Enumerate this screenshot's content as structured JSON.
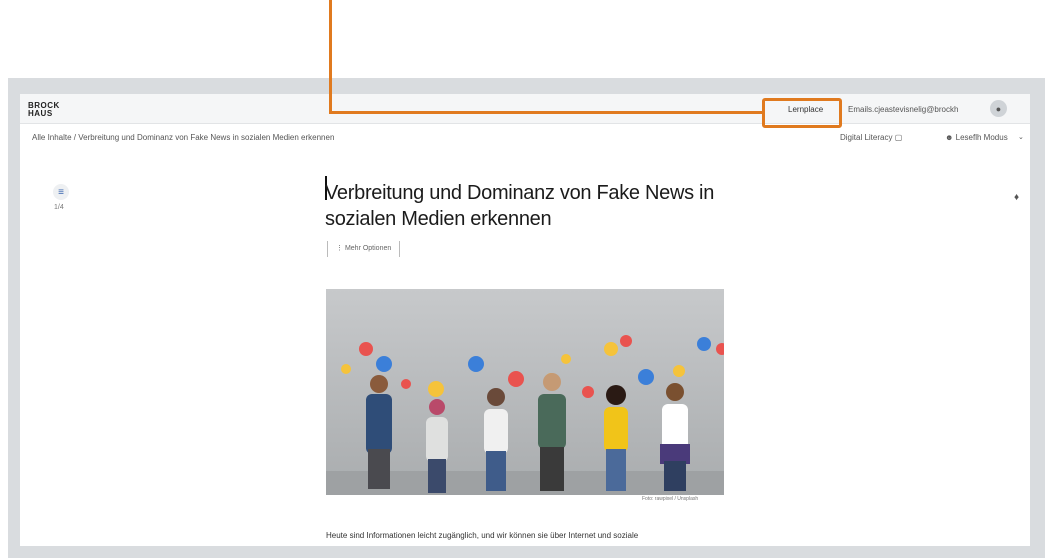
{
  "header": {
    "logo_line1": "BROCK",
    "logo_line2": "HAUS",
    "learning_link": "Lernplace",
    "user_email": "Emails.cjeastevisnelig@brockh",
    "avatar_icon": "user-icon"
  },
  "subbar": {
    "breadcrumb": "Alle Inhalte / Verbreitung und Dominanz von Fake News in sozialen Medien erkennen",
    "digital_label": "Digital Literacy",
    "lesemodus_label": "Leseflh Modus"
  },
  "sidebar": {
    "toc_icon": "list-icon",
    "toc_count": "1/4"
  },
  "article": {
    "title": "Verbreitung und Dominanz von Fake News in sozialen Medien erkennen",
    "meta_label": "Mehr Optionen",
    "image_credit": "Foto: rawpixel / Unsplash",
    "body_start": "Heute sind Informationen leicht zugänglich, und wir können sie über Internet und soziale"
  },
  "colors": {
    "annotation": "#e07a1f",
    "frame": "#d9dcdf"
  }
}
